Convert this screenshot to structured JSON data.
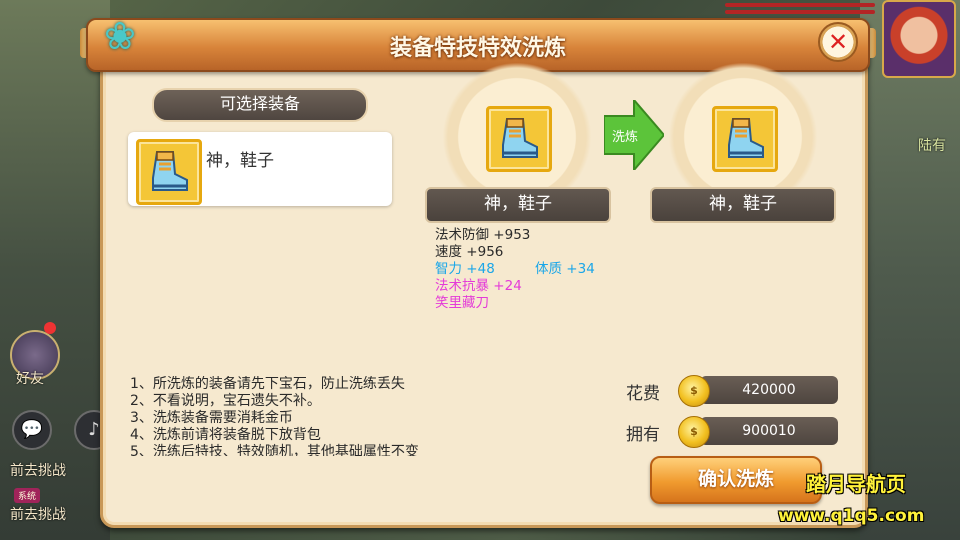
{
  "window": {
    "title": "装备特技特效洗炼",
    "close_label": "✕"
  },
  "left_panel": {
    "header": "可选择装备",
    "items": [
      {
        "name": "神，鞋子",
        "icon": "boots-icon"
      }
    ]
  },
  "before": {
    "name": "神，鞋子",
    "icon": "boots-icon"
  },
  "arrow_label": "洗炼",
  "after": {
    "name": "神，鞋子",
    "icon": "boots-icon"
  },
  "stats": {
    "line1": "法术防御  +953",
    "line2": "速度  +956",
    "line3a": "智力  +48",
    "line3b": "体质  +34",
    "line4": "法术抗暴  +24",
    "line5": "笑里藏刀"
  },
  "notes": [
    "1、所洗炼的装备请先下宝石，防止洗练丢失",
    "2、不看说明，宝石遗失不补。",
    "3、洗炼装备需要消耗金币",
    "4、洗炼前请将装备脱下放背包",
    "5、洗练后特技、特效随机，其他基础属性不变"
  ],
  "cost": {
    "label": "花费",
    "value": "420000",
    "coin_text": "$"
  },
  "own": {
    "label": "拥有",
    "value": "900010",
    "coin_text": "$"
  },
  "confirm_label": "确认洗炼",
  "background": {
    "friend_label": "好友",
    "challenge_1": "前去挑战",
    "tag": "系统",
    "challenge_2": "前去挑战",
    "right_text": "陆有"
  },
  "watermark": {
    "line1": "踏月导航页",
    "line2": "www.q1q5.com"
  },
  "colors": {
    "panel_bg": "#f6e9cf",
    "title_bar": "#d8843a",
    "stat_blue": "#1aa6e8",
    "stat_magenta": "#e43bd8",
    "confirm_btn": "#f09a2e"
  }
}
